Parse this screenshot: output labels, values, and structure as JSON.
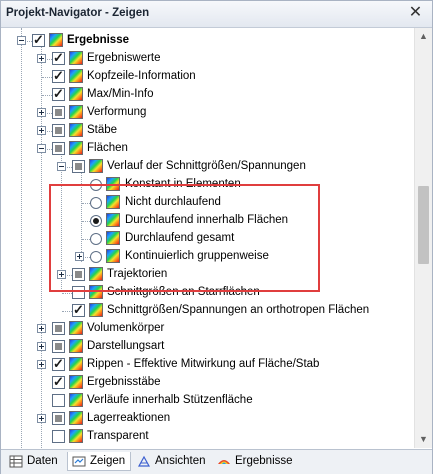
{
  "window": {
    "title": "Projekt-Navigator - Zeigen",
    "close_glyph": "✕"
  },
  "tree": {
    "items": [
      {
        "label": "Ergebnisse",
        "bold": true
      },
      {
        "label": "Ergebniswerte"
      },
      {
        "label": "Kopfzeile-Information"
      },
      {
        "label": "Max/Min-Info"
      },
      {
        "label": "Verformung"
      },
      {
        "label": "Stäbe"
      },
      {
        "label": "Flächen"
      },
      {
        "label": "Verlauf der Schnittgrößen/Spannungen"
      },
      {
        "label": "Konstant in Elementen"
      },
      {
        "label": "Nicht durchlaufend"
      },
      {
        "label": "Durchlaufend innerhalb Flächen"
      },
      {
        "label": "Durchlaufend gesamt"
      },
      {
        "label": "Kontinuierlich gruppenweise"
      },
      {
        "label": "Trajektorien"
      },
      {
        "label": "Schnittgrößen an Starrflächen"
      },
      {
        "label": "Schnittgrößen/Spannungen an orthotropen Flächen"
      },
      {
        "label": "Volumenkörper"
      },
      {
        "label": "Darstellungsart"
      },
      {
        "label": "Rippen - Effektive Mitwirkung auf Fläche/Stab"
      },
      {
        "label": "Ergebnisstäbe"
      },
      {
        "label": "Verläufe innerhalb Stützenfläche"
      },
      {
        "label": "Lagerreaktionen"
      },
      {
        "label": "Transparent"
      }
    ]
  },
  "tabs": [
    {
      "label": "Daten",
      "icon": "data-icon"
    },
    {
      "label": "Zeigen",
      "icon": "show-icon",
      "active": true
    },
    {
      "label": "Ansichten",
      "icon": "views-icon"
    },
    {
      "label": "Ergebnisse",
      "icon": "results-icon"
    }
  ],
  "colors": {
    "highlight_border": "#e03e3e",
    "panel_border": "#a9b3c3"
  }
}
